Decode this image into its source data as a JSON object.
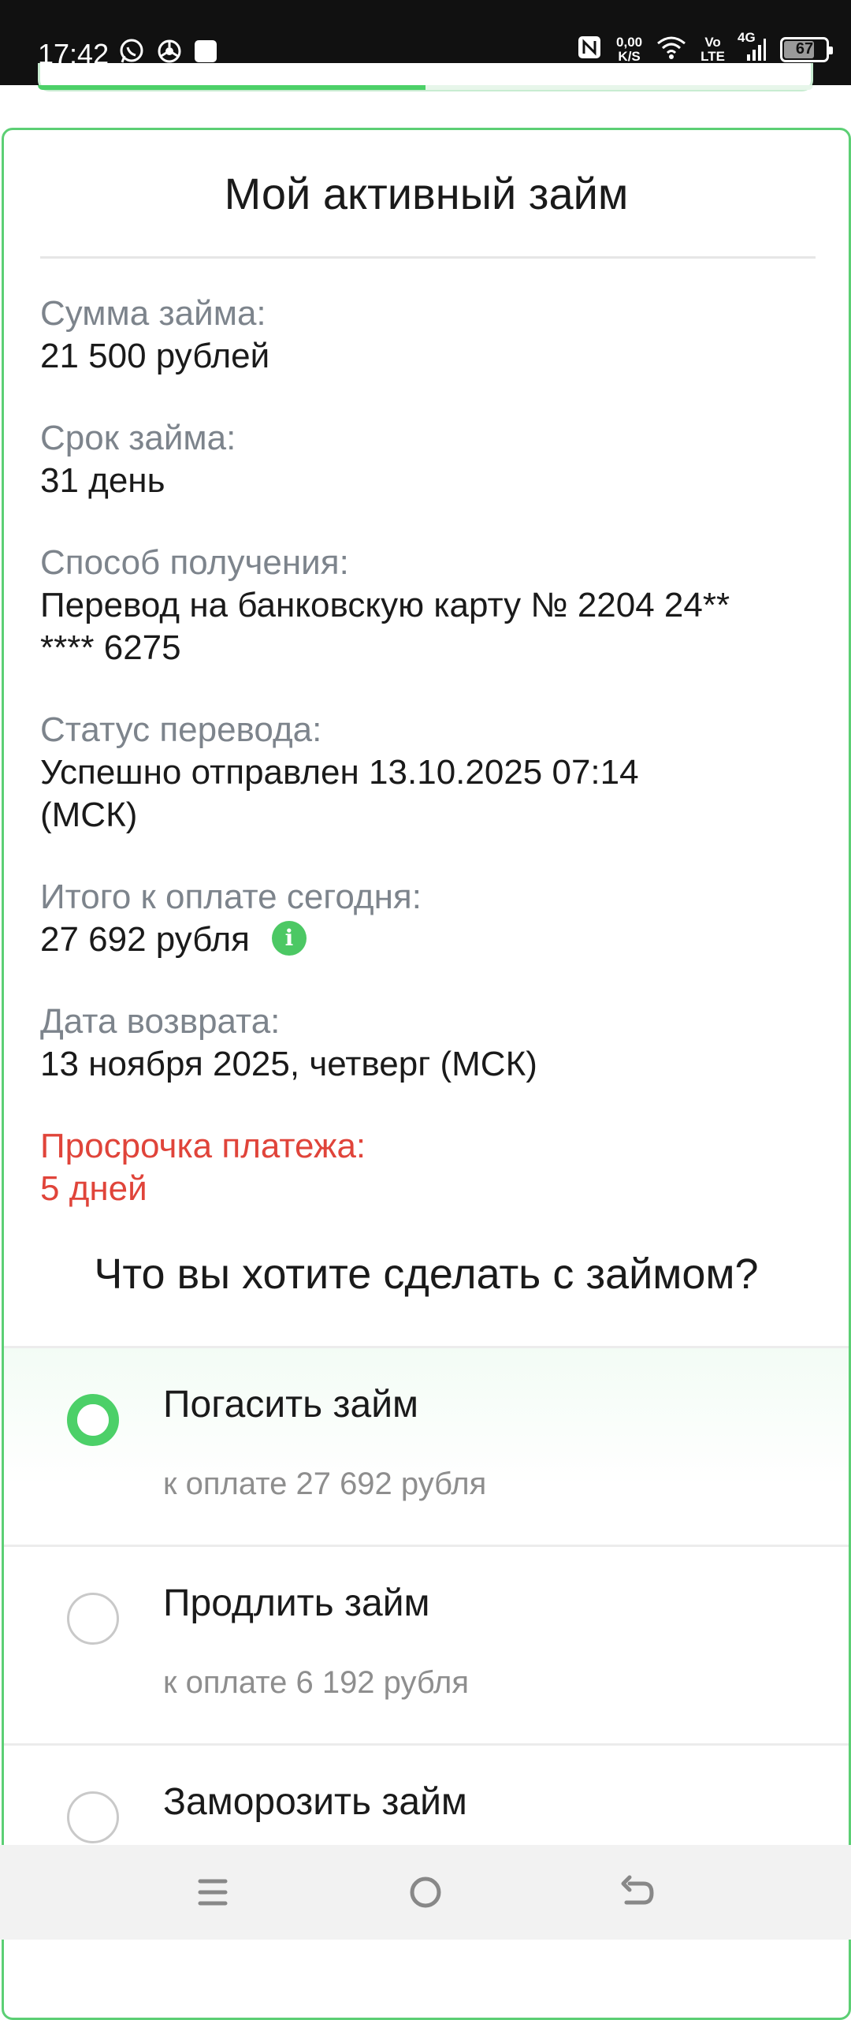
{
  "status_bar": {
    "time": "17:42",
    "left_icons": [
      "whatsapp-icon",
      "chrome-icon",
      "square-notification-icon"
    ],
    "net_speed_value": "0,00",
    "net_speed_unit": "K/S",
    "volte_top": "Vo",
    "volte_bottom": "LTE",
    "network": "4G",
    "battery": "67"
  },
  "loan_progress": 0.5,
  "card": {
    "title": "Мой активный займ",
    "fields": [
      {
        "label": "Сумма займа:",
        "value": "21 500 рублей"
      },
      {
        "label": "Срок займа:",
        "value": "31 день"
      },
      {
        "label": "Способ получения:",
        "value_line1": "Перевод на банковскую карту № 2204 24**",
        "value_line2": "**** 6275"
      },
      {
        "label": "Статус перевода:",
        "value_line1": "Успешно отправлен 13.10.2025 07:14",
        "value_line2": "(МСК)"
      },
      {
        "label": "Итого к оплате сегодня:",
        "value": "27 692 рубля"
      },
      {
        "label": "Дата возврата:",
        "value": "13 ноября 2025, четверг (МСК)"
      },
      {
        "label": "Просрочка платежа:",
        "value": "5 дней"
      }
    ],
    "question": "Что вы хотите сделать с займом?",
    "options": [
      {
        "title": "Погасить займ",
        "sub": "к оплате 27 692 рубля",
        "selected": true
      },
      {
        "title": "Продлить займ",
        "sub": "к оплате 6 192 рубля",
        "selected": false
      },
      {
        "title": "Заморозить займ",
        "sub": "",
        "selected": false
      }
    ]
  },
  "colors": {
    "accent": "#4cd068",
    "overdue": "#e0443a",
    "label_gray": "#7d848c"
  },
  "nav_bar": [
    "menu-icon",
    "home-icon",
    "back-icon"
  ]
}
